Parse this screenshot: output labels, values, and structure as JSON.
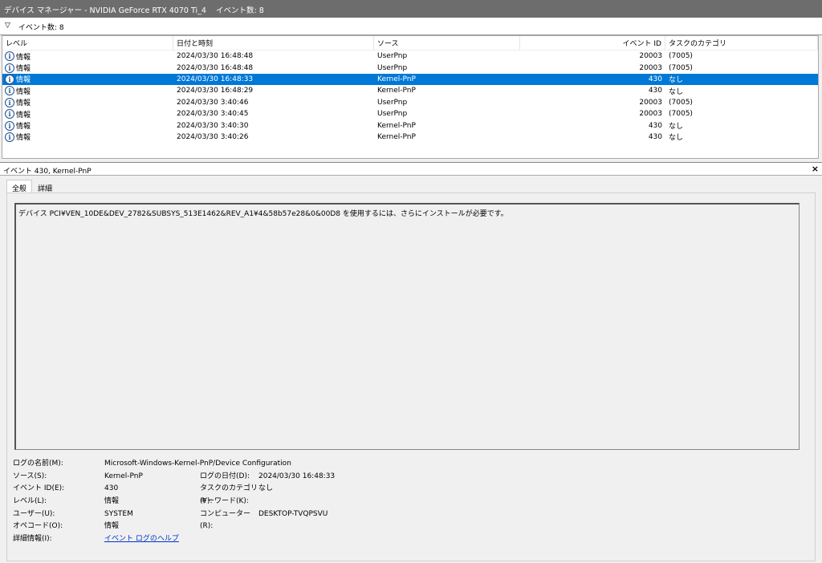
{
  "title": "デバイス マネージャー - NVIDIA GeForce RTX 4070 Ti_4    イベント数: 8",
  "filter": {
    "icon": "filter-icon",
    "label": "イベント数: 8"
  },
  "columns": [
    "レベル",
    "日付と時刻",
    "ソース",
    "イベント ID",
    "タスクのカテゴリ"
  ],
  "rows": [
    {
      "level": "情報",
      "date": "2024/03/30 16:48:48",
      "source": "UserPnp",
      "id": "20003",
      "cat": "(7005)"
    },
    {
      "level": "情報",
      "date": "2024/03/30 16:48:48",
      "source": "UserPnp",
      "id": "20003",
      "cat": "(7005)"
    },
    {
      "level": "情報",
      "date": "2024/03/30 16:48:33",
      "source": "Kernel-PnP",
      "id": "430",
      "cat": "なし"
    },
    {
      "level": "情報",
      "date": "2024/03/30 16:48:29",
      "source": "Kernel-PnP",
      "id": "430",
      "cat": "なし"
    },
    {
      "level": "情報",
      "date": "2024/03/30 3:40:46",
      "source": "UserPnp",
      "id": "20003",
      "cat": "(7005)"
    },
    {
      "level": "情報",
      "date": "2024/03/30 3:40:45",
      "source": "UserPnp",
      "id": "20003",
      "cat": "(7005)"
    },
    {
      "level": "情報",
      "date": "2024/03/30 3:40:30",
      "source": "Kernel-PnP",
      "id": "430",
      "cat": "なし"
    },
    {
      "level": "情報",
      "date": "2024/03/30 3:40:26",
      "source": "Kernel-PnP",
      "id": "430",
      "cat": "なし"
    }
  ],
  "detail": {
    "header": "イベント 430, Kernel-PnP",
    "close": "×",
    "tabs": [
      "全般",
      "詳細"
    ],
    "message": "デバイス PCI¥VEN_10DE&DEV_2782&SUBSYS_513E1462&REV_A1¥4&58b57e28&0&00D8 を使用するには、さらにインストールが必要です。",
    "log_name_label": "ログの名前(M):",
    "log_name": "Microsoft-Windows-Kernel-PnP/Device Configuration",
    "source_label": "ソース(S):",
    "source": "Kernel-PnP",
    "date_label": "ログの日付(D):",
    "date": "2024/03/30 16:48:33",
    "id_label": "イベント ID(E):",
    "id": "430",
    "cat_label": "タスクのカテゴリ(Y):",
    "cat": "なし",
    "level_label": "レベル(L):",
    "level": "情報",
    "kw_label": "キーワード(K):",
    "user_label": "ユーザー(U):",
    "user": "SYSTEM",
    "computer_label": "コンピューター(R):",
    "computer": "DESKTOP-TVQPSVU",
    "opcode_label": "オペコード(O):",
    "opcode": "情報",
    "more_label": "詳細情報(I):",
    "more_link": "イベント ログのヘルプ"
  }
}
